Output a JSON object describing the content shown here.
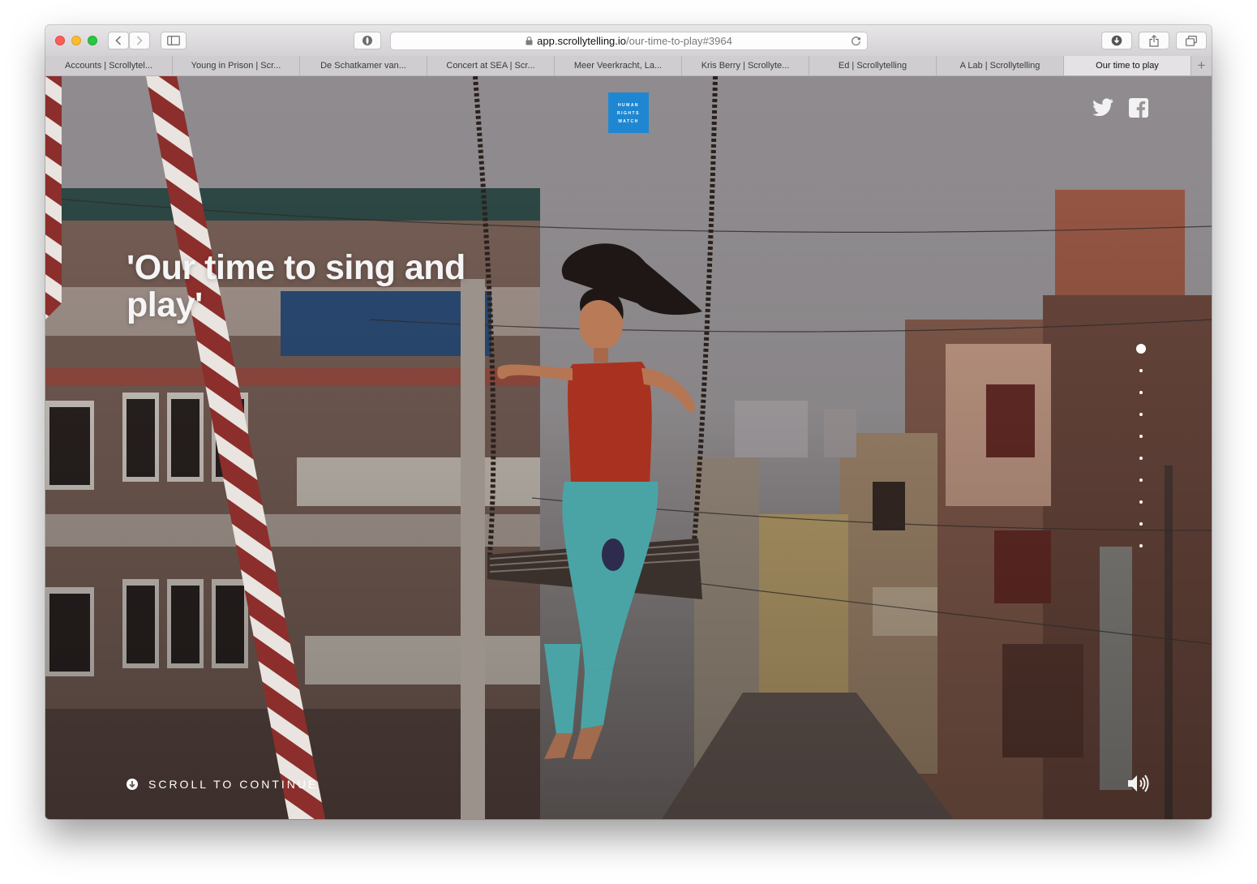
{
  "browser": {
    "url_host": "app.scrollytelling.io",
    "url_path": "/our-time-to-play#3964",
    "tabs": [
      {
        "label": "Accounts | Scrollytel..."
      },
      {
        "label": "Young in Prison | Scr..."
      },
      {
        "label": "De Schatkamer van..."
      },
      {
        "label": "Concert at SEA | Scr..."
      },
      {
        "label": "Meer Veerkracht, La..."
      },
      {
        "label": "Kris Berry | Scrollyte..."
      },
      {
        "label": "Ed | Scrollytelling"
      },
      {
        "label": "A Lab | Scrollytelling"
      },
      {
        "label": "Our time to play"
      }
    ],
    "active_tab_index": 8
  },
  "page": {
    "logo_lines": [
      "HUMAN",
      "RIGHTS",
      "WATCH"
    ],
    "headline": "'Our time to sing and play'",
    "scroll_cta": "SCROLL TO CONTINUE",
    "section_count": 10,
    "active_section": 1
  },
  "icons": {
    "share": [
      "twitter-icon",
      "facebook-icon"
    ],
    "audio": "speaker-icon",
    "scroll": "arrow-down-circle-icon"
  },
  "colors": {
    "logo_bg": "#1f87d2",
    "headline": "#f5f5f5"
  }
}
